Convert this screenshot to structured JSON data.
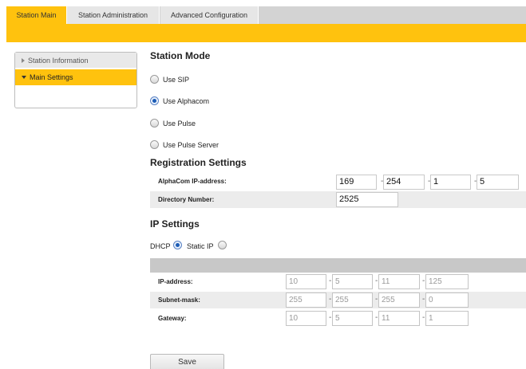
{
  "tabs": [
    {
      "label": "Station Main",
      "active": true
    },
    {
      "label": "Station Administration",
      "active": false
    },
    {
      "label": "Advanced Configuration",
      "active": false
    }
  ],
  "sidebar": {
    "items": [
      {
        "label": "Station Information",
        "expanded": false
      },
      {
        "label": "Main Settings",
        "expanded": true
      }
    ]
  },
  "station_mode": {
    "title": "Station Mode",
    "options": [
      {
        "label": "Use SIP",
        "selected": false
      },
      {
        "label": "Use Alphacom",
        "selected": true
      },
      {
        "label": "Use Pulse",
        "selected": false
      },
      {
        "label": "Use Pulse Server",
        "selected": false
      }
    ]
  },
  "registration": {
    "title": "Registration Settings",
    "alphacom_ip_label": "AlphaCom IP-address:",
    "alphacom_ip": [
      "169",
      "254",
      "1",
      "5"
    ],
    "directory_label": "Directory Number:",
    "directory_number": "2525"
  },
  "ip_settings": {
    "title": "IP Settings",
    "dhcp_label": "DHCP",
    "dhcp_selected": true,
    "static_label": "Static IP",
    "static_selected": false,
    "ip_label": "IP-address:",
    "ip": [
      "10",
      "5",
      "11",
      "125"
    ],
    "subnet_label": "Subnet-mask:",
    "subnet": [
      "255",
      "255",
      "255",
      "0"
    ],
    "gateway_label": "Gateway:",
    "gateway": [
      "10",
      "5",
      "11",
      "1"
    ]
  },
  "save_label": "Save",
  "colors": {
    "accent": "#ffc20e",
    "tab_gray": "#d3d3d3",
    "radio_selected": "#1b5bb5"
  }
}
